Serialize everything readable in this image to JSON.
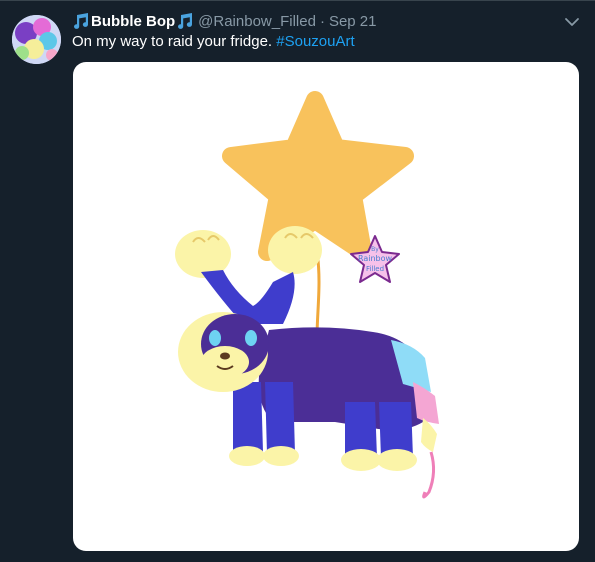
{
  "tweet": {
    "display_name": "Bubble Bop",
    "handle": "@Rainbow_Filled",
    "separator": "·",
    "timestamp": "Sep 21",
    "text_prefix": "On my way to raid your fridge. ",
    "hashtag": "#SouzouArt",
    "media": {
      "watermark_lines": [
        "By",
        "Rainbow",
        "Filled"
      ]
    },
    "colors": {
      "background": "#15202b",
      "name": "#ffffff",
      "meta": "#8899a6",
      "link": "#1da1f2",
      "note_icon": "#4aa3df"
    },
    "icons": [
      "music-note-icon",
      "chevron-down-icon"
    ]
  }
}
